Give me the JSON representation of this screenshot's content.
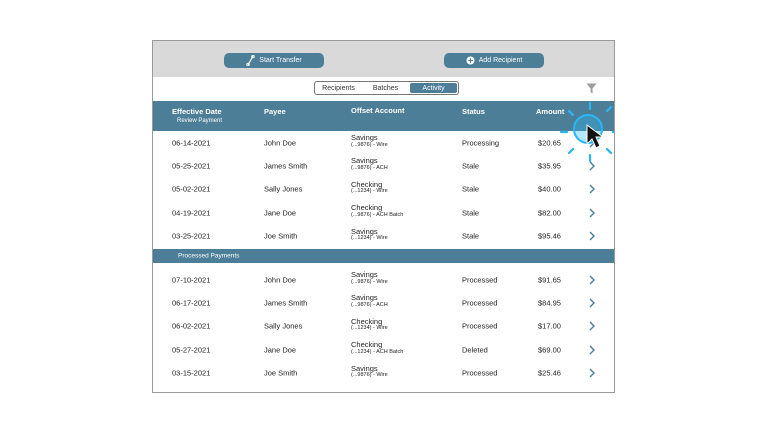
{
  "toolbar": {
    "start_transfer_label": "Start Transfer",
    "add_recipient_label": "Add Recipient"
  },
  "tabs": [
    {
      "label": "Recipients",
      "active": false
    },
    {
      "label": "Batches",
      "active": false
    },
    {
      "label": "Activity",
      "active": true
    }
  ],
  "table": {
    "headers": {
      "date": "Effective Date",
      "date_sub": "Review Payment",
      "payee": "Payee",
      "offset": "Offset Account",
      "status": "Status",
      "amount": "Amount"
    },
    "review_rows": [
      {
        "date": "06-14-2021",
        "payee": "John Doe",
        "account": "Savings",
        "account_detail": "(...9876) - Wire",
        "status": "Processing",
        "amount": "$20.65"
      },
      {
        "date": "05-25-2021",
        "payee": "James Smith",
        "account": "Savings",
        "account_detail": "(...9876) - ACH",
        "status": "Stale",
        "amount": "$35.95"
      },
      {
        "date": "05-02-2021",
        "payee": "Sally Jones",
        "account": "Checking",
        "account_detail": "(...1234) - Wire",
        "status": "Stale",
        "amount": "$40.00"
      },
      {
        "date": "04-19-2021",
        "payee": "Jane Doe",
        "account": "Checking",
        "account_detail": "(...9876) - ACH Batch",
        "status": "Stale",
        "amount": "$82.00"
      },
      {
        "date": "03-25-2021",
        "payee": "Joe Smith",
        "account": "Savings",
        "account_detail": "(...1234) - Wire",
        "status": "Stale",
        "amount": "$95.46"
      }
    ],
    "processed_label": "Processed Payments",
    "processed_rows": [
      {
        "date": "07-10-2021",
        "payee": "John Doe",
        "account": "Savings",
        "account_detail": "(...9876) - Wire",
        "status": "Processed",
        "amount": "$91.65"
      },
      {
        "date": "06-17-2021",
        "payee": "James Smith",
        "account": "Savings",
        "account_detail": "(...9876) - ACH",
        "status": "Processed",
        "amount": "$84.95"
      },
      {
        "date": "06-02-2021",
        "payee": "Sally Jones",
        "account": "Checking",
        "account_detail": "(...1234) - Wire",
        "status": "Processed",
        "amount": "$17.00"
      },
      {
        "date": "05-27-2021",
        "payee": "Jane Doe",
        "account": "Checking",
        "account_detail": "(...1234) - ACH Batch",
        "status": "Deleted",
        "amount": "$69.00"
      },
      {
        "date": "03-15-2021",
        "payee": "Joe Smith",
        "account": "Savings",
        "account_detail": "(...9876) - Wire",
        "status": "Processed",
        "amount": "$25.46"
      }
    ]
  },
  "icons": {
    "transfer": "transfer-icon",
    "add": "plus-circle-icon",
    "filter": "filter-icon",
    "row_action": "chevron-right-icon",
    "cursor": "cursor-icon"
  },
  "colors": {
    "accent": "#4d7e97",
    "toolbar_bg": "#d9d9d9",
    "chevron": "#4d7e97",
    "click_highlight": "#29b6f6"
  }
}
